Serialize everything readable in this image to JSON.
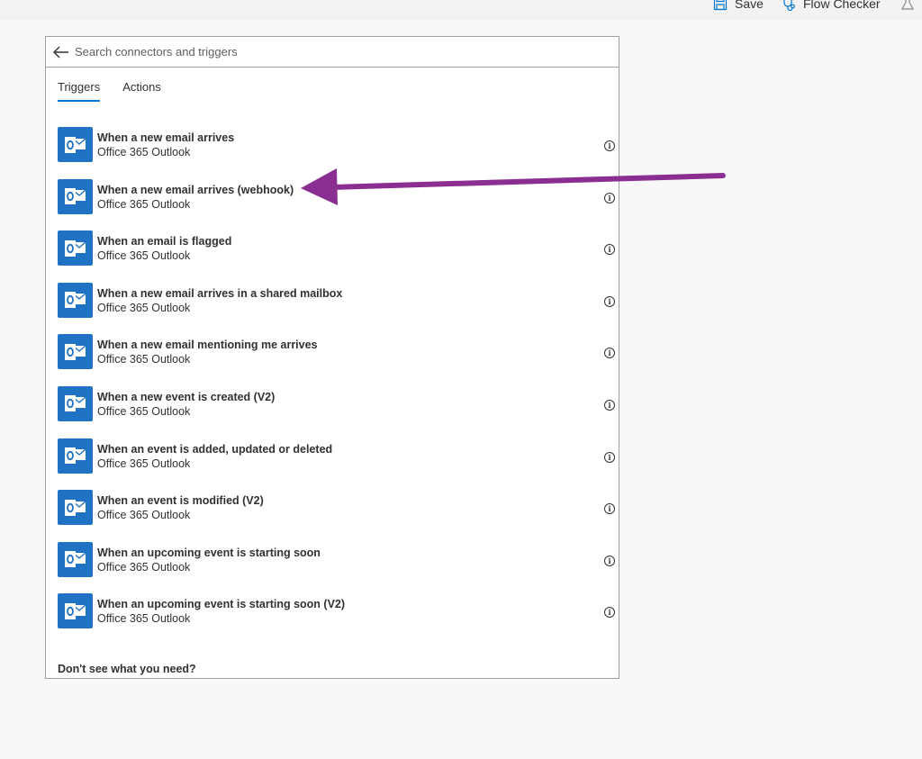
{
  "toolbar": {
    "save_label": "Save",
    "flow_checker_label": "Flow Checker"
  },
  "search": {
    "placeholder": "Search connectors and triggers",
    "value": ""
  },
  "tabs": [
    {
      "label": "Triggers",
      "active": true
    },
    {
      "label": "Actions",
      "active": false
    }
  ],
  "triggers": [
    {
      "title": "When a new email arrives",
      "connector": "Office 365 Outlook"
    },
    {
      "title": "When a new email arrives (webhook)",
      "connector": "Office 365 Outlook"
    },
    {
      "title": "When an email is flagged",
      "connector": "Office 365 Outlook"
    },
    {
      "title": "When a new email arrives in a shared mailbox",
      "connector": "Office 365 Outlook"
    },
    {
      "title": "When a new email mentioning me arrives",
      "connector": "Office 365 Outlook"
    },
    {
      "title": "When a new event is created (V2)",
      "connector": "Office 365 Outlook"
    },
    {
      "title": "When an event is added, updated or deleted",
      "connector": "Office 365 Outlook"
    },
    {
      "title": "When an event is modified (V2)",
      "connector": "Office 365 Outlook"
    },
    {
      "title": "When an upcoming event is starting soon",
      "connector": "Office 365 Outlook"
    },
    {
      "title": "When an upcoming event is starting soon (V2)",
      "connector": "Office 365 Outlook"
    }
  ],
  "footer": {
    "help_text": "Don't see what you need?"
  },
  "icons": {
    "save": "save-icon",
    "flow_checker": "stethoscope-icon",
    "test": "beaker-icon",
    "back": "back-arrow-icon",
    "connector": "outlook-icon",
    "info": "info-icon"
  },
  "colors": {
    "accent": "#0078d4",
    "outlook_tile": "#2072c5",
    "annotation_arrow": "#8a2e91",
    "panel_border": "#a19f9d"
  }
}
